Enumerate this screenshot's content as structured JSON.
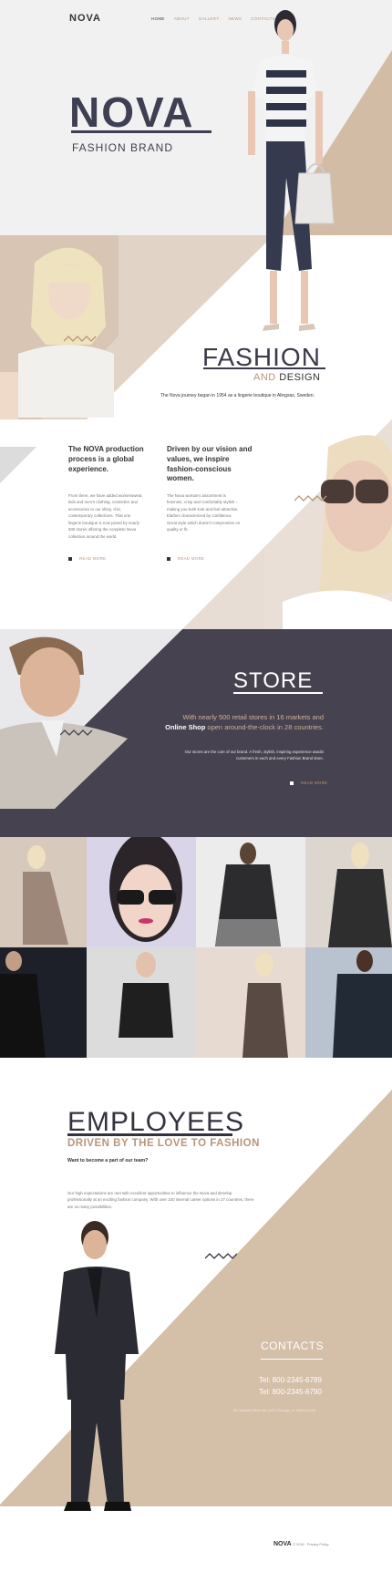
{
  "brand": {
    "logo": "NOVA"
  },
  "nav": {
    "items": [
      "HOME",
      "ABOUT",
      "GALLERY",
      "NEWS",
      "CONTACTS"
    ]
  },
  "hero": {
    "title": "NOVA",
    "subtitle": "FASHION BRAND"
  },
  "fashion": {
    "title": "FASHION",
    "and": "AND",
    "design": "DESIGN",
    "journey": "The Nova journey began in 1954 as a lingerie boutique in Alingsas, Sweden."
  },
  "columns": [
    {
      "heading": "The NOVA production process is a global experience.",
      "body": "From there, we have added womenswear, kids and men's clothing, cosmetics and accessories to our shiny, chic, contemporary collections. That one lingerie boutique is now joined by nearly 500 stores offering the complete Nova collection around the world.",
      "link": "READ MORE"
    },
    {
      "heading": "Driven by our vision and values, we inspire fashion-conscious women.",
      "body": "The Nova woman's assortment is feminine, crisp and comfortably stylish – making you both look and feel attractive. Elathes characterized by confidence. Great style which doesn't compromise on quality or fit.",
      "link": "READ MORE"
    }
  ],
  "store": {
    "title": "STORE",
    "line1": "With nearly 500 retail stores in 16 markets and",
    "shop": "Online Shop",
    "line2": "open around-the-clock in 28 countries.",
    "body": "Our stores are the core of our brand. A fresh, stylish, inspiring experience awaits customers in each and every Fashion Brand store.",
    "link": "READ MORE"
  },
  "employees": {
    "title": "EMPLOYEES",
    "subtitle": "DRIVEN BY THE LOVE TO FASHION",
    "question": "Want to become a part of our team?",
    "body": "Our high expectations are met with excellent opportunities to influence the Nova and develop professionally at an exciting fashion company. With over 100 internal career options in 27 countries, there are so many possibilities."
  },
  "contacts": {
    "title": "CONTACTS",
    "tel1": "Tel: 800-2345-6789",
    "tel2": "Tel: 800-2345-6790",
    "address": "28 Jackson Blvd Ste 1020 Chicago, IL 60604-2340"
  },
  "footer": {
    "brand": "NOVA",
    "copyright": "© 2016 · Privacy Policy"
  },
  "colors": {
    "accent": "#b9957a",
    "beige": "#d2bba5",
    "dark": "#45424f",
    "light_gray": "#f1f1f1"
  }
}
